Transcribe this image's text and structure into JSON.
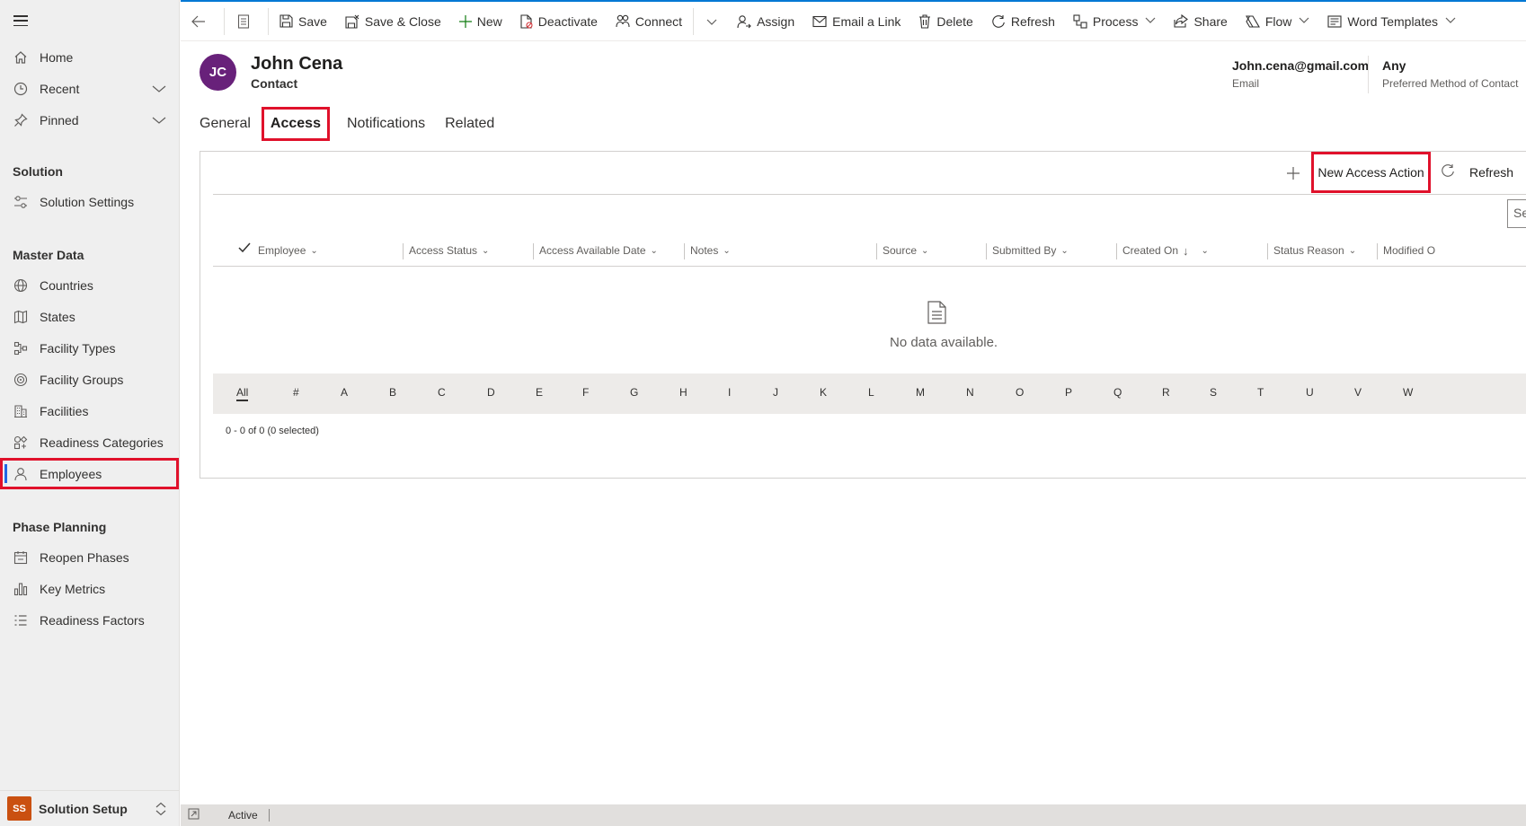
{
  "sidebar": {
    "top_items": [
      {
        "label": "Home",
        "icon": "home-icon"
      },
      {
        "label": "Recent",
        "icon": "clock-icon",
        "chevron": true
      },
      {
        "label": "Pinned",
        "icon": "pin-icon",
        "chevron": true
      }
    ],
    "groups": [
      {
        "title": "Solution",
        "items": [
          {
            "label": "Solution Settings",
            "icon": "settings-icon"
          }
        ]
      },
      {
        "title": "Master Data",
        "items": [
          {
            "label": "Countries",
            "icon": "globe-icon"
          },
          {
            "label": "States",
            "icon": "map-icon"
          },
          {
            "label": "Facility Types",
            "icon": "hierarchy-icon"
          },
          {
            "label": "Facility Groups",
            "icon": "target-icon"
          },
          {
            "label": "Facilities",
            "icon": "building-icon"
          },
          {
            "label": "Readiness Categories",
            "icon": "categories-icon"
          },
          {
            "label": "Employees",
            "icon": "person-icon",
            "active": true
          }
        ]
      },
      {
        "title": "Phase Planning",
        "items": [
          {
            "label": "Reopen Phases",
            "icon": "calendar-icon"
          },
          {
            "label": "Key Metrics",
            "icon": "bar-chart-icon"
          },
          {
            "label": "Readiness Factors",
            "icon": "list-icon"
          }
        ]
      }
    ],
    "area": {
      "badge": "SS",
      "label": "Solution Setup"
    }
  },
  "commands": [
    "Save",
    "Save & Close",
    "New",
    "Deactivate",
    "Connect",
    "Assign",
    "Email a Link",
    "Delete",
    "Refresh",
    "Process",
    "Share",
    "Flow",
    "Word Templates"
  ],
  "record": {
    "initials": "JC",
    "name": "John Cena",
    "type": "Contact",
    "email_value": "John.cena@gmail.com",
    "email_label": "Email",
    "method_value": "Any",
    "method_label": "Preferred Method of Contact"
  },
  "tabs": [
    "General",
    "Access",
    "Notifications",
    "Related"
  ],
  "subgrid": {
    "new_action": "New Access Action",
    "refresh": "Refresh",
    "search_placeholder": "Sea",
    "columns": [
      "Employee",
      "Access Status",
      "Access Available Date",
      "Notes",
      "Source",
      "Submitted By",
      "Created On",
      "Status Reason",
      "Modified O"
    ],
    "empty": "No data available.",
    "jump": [
      "All",
      "#",
      "A",
      "B",
      "C",
      "D",
      "E",
      "F",
      "G",
      "H",
      "I",
      "J",
      "K",
      "L",
      "M",
      "N",
      "O",
      "P",
      "Q",
      "R",
      "S",
      "T",
      "U",
      "V",
      "W"
    ],
    "paging": "0 - 0 of 0 (0 selected)"
  },
  "status": {
    "state": "Active"
  },
  "colors": {
    "accent": "#0078d4",
    "highlight": "#e0112b",
    "avatar": "#68217a",
    "area_badge": "#ca5010"
  }
}
